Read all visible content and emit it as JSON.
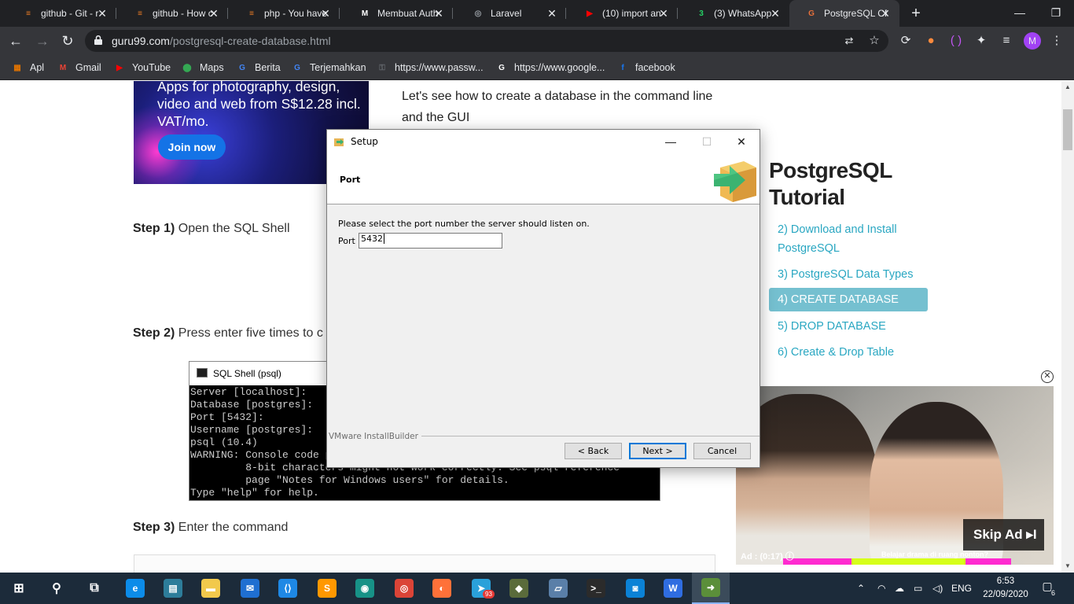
{
  "browser": {
    "tabs": [
      {
        "title": "github - Git - r",
        "favicon": "stackoverflow-icon",
        "color": "#f48024",
        "glyph": "≡"
      },
      {
        "title": "github - How c",
        "favicon": "stackoverflow-icon",
        "color": "#f48024",
        "glyph": "≡"
      },
      {
        "title": "php - You have",
        "favicon": "stackoverflow-icon",
        "color": "#f48024",
        "glyph": "≡"
      },
      {
        "title": "Membuat Auth",
        "favicon": "medium-icon",
        "color": "#ffffff",
        "glyph": "M"
      },
      {
        "title": "Laravel",
        "favicon": "globe-icon",
        "color": "#9aa0a6",
        "glyph": "◎"
      },
      {
        "title": "(10) import an",
        "favicon": "youtube-icon",
        "color": "#ff0000",
        "glyph": "▶"
      },
      {
        "title": "(3) WhatsApp",
        "favicon": "whatsapp-icon",
        "color": "#25d366",
        "glyph": "3"
      },
      {
        "title": "PostgreSQL CR",
        "favicon": "guru99-icon",
        "color": "#e8703a",
        "glyph": "G"
      }
    ],
    "new_tab_label": "+",
    "window_controls": {
      "minimize": "—",
      "restore": "❐",
      "close": "✕"
    },
    "url_host": "guru99.com",
    "url_path": "/postgresql-create-database.html",
    "profile_initial": "M",
    "bookmarks": [
      {
        "label": "Apl",
        "icon": "apps-grid-icon",
        "color": "#e37400",
        "glyph": "▦"
      },
      {
        "label": "Gmail",
        "icon": "gmail-icon",
        "color": "#ea4335",
        "glyph": "M"
      },
      {
        "label": "YouTube",
        "icon": "youtube-icon",
        "color": "#ff0000",
        "glyph": "▶"
      },
      {
        "label": "Maps",
        "icon": "maps-pin-icon",
        "color": "#34a853",
        "glyph": "⬤"
      },
      {
        "label": "Berita",
        "icon": "news-icon",
        "color": "#4285f4",
        "glyph": "G"
      },
      {
        "label": "Terjemahkan",
        "icon": "translate-icon",
        "color": "#4285f4",
        "glyph": "G"
      },
      {
        "label": "https://www.passw...",
        "icon": "key-icon",
        "color": "#5f6368",
        "glyph": "⚿"
      },
      {
        "label": "https://www.google...",
        "icon": "google-icon",
        "color": "#ffffff",
        "glyph": "G"
      },
      {
        "label": "facebook",
        "icon": "facebook-icon",
        "color": "#1877f2",
        "glyph": "f"
      }
    ]
  },
  "page": {
    "ad_banner_text": "Apps for photography, design, video and web from S$12.28 incl. VAT/mo.",
    "ad_banner_button": "Join now",
    "intro_text": "Let's see how to create a database in the command line and the GUI",
    "step1_bold": "Step 1)",
    "step1_text": " Open the SQL Shell",
    "step2_bold": "Step 2)",
    "step2_text": " Press enter five times to c",
    "step3_bold": "Step 3)",
    "step3_text": " Enter the command",
    "sql_window_title": "SQL Shell (psql)",
    "sql_window_lines": "Server [localhost]:\nDatabase [postgres]:\nPort [5432]:\nUsername [postgres]:\npsql (10.4)\nWARNING: Console code page (437) differs from Windows code page (1252)\n         8-bit characters might not work correctly. See psql reference\n         page \"Notes for Windows users\" for details.\nType \"help\" for help.",
    "sidebar_title": "PostgreSQL Tutorial",
    "sidebar_links": [
      "2) Download and Install PostgreSQL",
      "3) PostgreSQL Data Types",
      "4) CREATE DATABASE",
      "5) DROP DATABASE",
      "6) Create & Drop Table"
    ],
    "video_ad": {
      "skip_label": "Skip Ad ▸I",
      "ad_timer": "Ad : (0:17)",
      "caption": "Belajar drama di ruang nonton?",
      "close_glyph": "✕"
    }
  },
  "setup_dialog": {
    "title": "Setup",
    "header_title": "Port",
    "prompt": "Please select the port number the server should listen on.",
    "port_label": "Port",
    "port_value": "5432",
    "vendor": "VMware InstallBuilder",
    "back_label": "< Back",
    "next_label": "Next >",
    "cancel_label": "Cancel"
  },
  "taskbar": {
    "items": [
      {
        "name": "start-button",
        "glyph": "⊞",
        "color": "transparent"
      },
      {
        "name": "search-icon",
        "glyph": "⚲",
        "color": "transparent"
      },
      {
        "name": "task-view-icon",
        "glyph": "⧉",
        "color": "transparent"
      },
      {
        "name": "edge-icon",
        "glyph": "e",
        "color": "#0c8ce9"
      },
      {
        "name": "store-icon",
        "glyph": "▤",
        "color": "#2d7d9a"
      },
      {
        "name": "file-explorer-icon",
        "glyph": "▬",
        "color": "#f2c94c"
      },
      {
        "name": "mail-icon",
        "glyph": "✉",
        "color": "#1f6fd1"
      },
      {
        "name": "vscode-icon",
        "glyph": "⟨⟩",
        "color": "#1e88e5"
      },
      {
        "name": "sublime-icon",
        "glyph": "S",
        "color": "#ff9800"
      },
      {
        "name": "gitkraken-icon",
        "glyph": "◉",
        "color": "#179287"
      },
      {
        "name": "chrome-icon",
        "glyph": "◎",
        "color": "#db4437"
      },
      {
        "name": "firefox-icon",
        "glyph": "◐",
        "color": "#ff7139"
      },
      {
        "name": "telegram-icon",
        "glyph": "➤",
        "color": "#2aa1da"
      },
      {
        "name": "git-icon",
        "glyph": "◆",
        "color": "#5a6b3b"
      },
      {
        "name": "notes-icon",
        "glyph": "▱",
        "color": "#5a7fa8"
      },
      {
        "name": "terminal-icon",
        "glyph": ">_",
        "color": "#2b2b2b"
      },
      {
        "name": "camera-app-icon",
        "glyph": "◙",
        "color": "#0b82d6"
      },
      {
        "name": "wps-icon",
        "glyph": "W",
        "color": "#2f6de1"
      },
      {
        "name": "setup-installer-icon",
        "glyph": "➜",
        "color": "#5b8f3a"
      }
    ],
    "telegram_badge": "93",
    "tray_language": "ENG",
    "time": "6:53",
    "date": "22/09/2020",
    "notification_count": "6"
  }
}
